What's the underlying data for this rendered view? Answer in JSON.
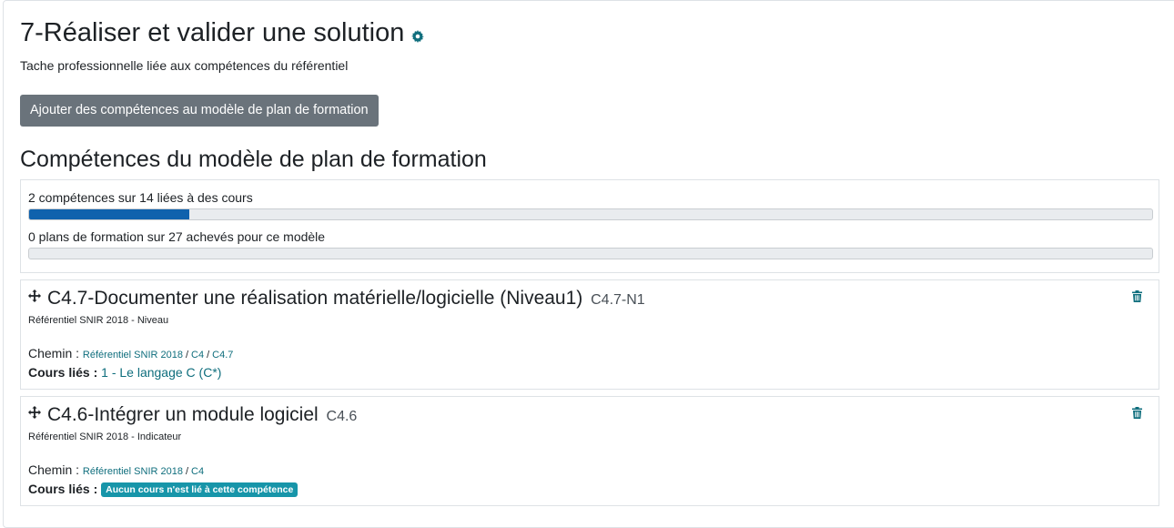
{
  "page": {
    "title": "7-Réaliser et valider une solution",
    "subtitle": "Tache professionnelle liée aux compétences du référentiel",
    "add_button": "Ajouter des compétences au modèle de plan de formation",
    "section_title": "Compétences du modèle de plan de formation"
  },
  "stats": {
    "linked_label": "2 compétences sur 14 liées à des cours",
    "linked_progress": 0.143,
    "completed_label": "0 plans de formation sur 27 achevés pour ce modèle",
    "completed_progress": 0
  },
  "competencies": [
    {
      "name": "C4.7-Documenter une réalisation matérielle/logicielle (Niveau1)",
      "idnumber": "C4.7-N1",
      "framework": "Référentiel SNIR 2018 - Niveau",
      "path_label": "Chemin :",
      "path": [
        "Référentiel SNIR 2018",
        "C4",
        "C4.7"
      ],
      "courses_label": "Cours liés :",
      "course": "1 - Le langage C (C*)"
    },
    {
      "name": "C4.6-Intégrer un module logiciel",
      "idnumber": "C4.6",
      "framework": "Référentiel SNIR 2018 - Indicateur",
      "path_label": "Chemin :",
      "path": [
        "Référentiel SNIR 2018",
        "C4"
      ],
      "courses_label": "Cours liés :",
      "no_course_badge": "Aucun cours n'est lié à cette compétence"
    }
  ],
  "path_separator": "/",
  "icons": {
    "gear": "gear-icon",
    "move": "move-icon",
    "trash": "trash-icon"
  },
  "colors": {
    "accent": "#0f6e7d",
    "progress": "#0f62ad",
    "button": "#6a737b",
    "badge": "#1795a9"
  }
}
